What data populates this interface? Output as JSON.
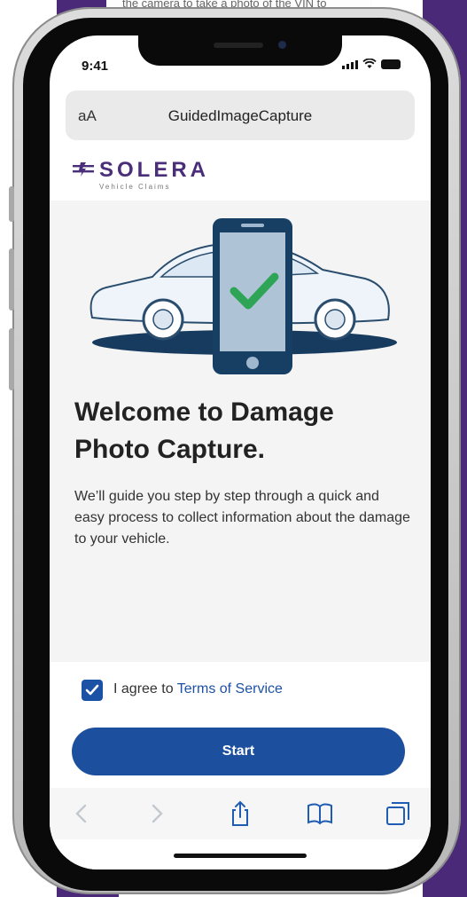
{
  "background": {
    "partial_text": "the camera to take a photo of the VIN to",
    "accent_color": "#4a2a78"
  },
  "status_bar": {
    "time": "9:41"
  },
  "browser": {
    "text_size_button": "aA",
    "page_title": "GuidedImageCapture"
  },
  "brand": {
    "name": "SOLERA",
    "tagline": "Vehicle Claims",
    "color": "#4a2e79"
  },
  "welcome": {
    "heading": "Welcome to Damage Photo Capture.",
    "description": "We’ll guide you step by step through a quick and easy process to collect information about the damage to your vehicle."
  },
  "agreement": {
    "checked": true,
    "prefix": "I agree to ",
    "link_text": "Terms of Service"
  },
  "start_button": {
    "label": "Start",
    "color": "#1d4f9f"
  },
  "toolbar": {
    "icons": [
      "back-icon",
      "forward-icon",
      "share-icon",
      "bookmarks-icon",
      "tabs-icon"
    ]
  }
}
